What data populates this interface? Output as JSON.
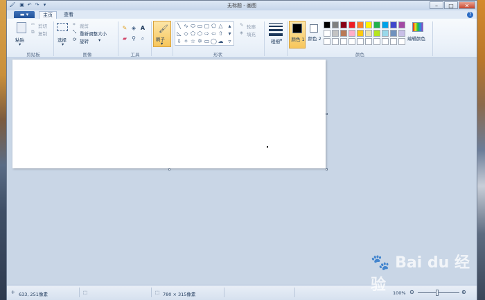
{
  "window": {
    "title": "无标题 - 画图",
    "file_menu": "▾",
    "quick_access": [
      "save-icon",
      "undo-icon",
      "redo-icon",
      "customize-icon"
    ],
    "controls": {
      "minimize": "–",
      "maximize": "□",
      "close": "✕"
    }
  },
  "tabs": {
    "home": "主页",
    "view": "查看"
  },
  "ribbon": {
    "clipboard": {
      "paste": "粘贴",
      "cut": "剪切",
      "copy": "复制",
      "label": "剪贴板"
    },
    "image": {
      "select": "选择",
      "crop": "裁剪",
      "resize": "重新调整大小",
      "rotate": "旋转",
      "label": "图像"
    },
    "tools": {
      "label": "工具"
    },
    "brushes": {
      "label": "刷子"
    },
    "shapes": {
      "outline": "轮廓",
      "fill": "填充",
      "label": "形状"
    },
    "size": {
      "label": "粗细"
    },
    "colors": {
      "color1": "颜色 1",
      "color2": "颜色 2",
      "edit": "编辑颜色",
      "label": "颜色",
      "color1_value": "#000000",
      "color2_value": "#ffffff",
      "palette_row1": [
        "#000000",
        "#7f7f7f",
        "#880015",
        "#ed1c24",
        "#ff7f27",
        "#fff200",
        "#22b14c",
        "#00a2e8",
        "#3f48cc",
        "#a349a4"
      ],
      "palette_row2": [
        "#ffffff",
        "#c3c3c3",
        "#b97a57",
        "#ffaec9",
        "#ffc90e",
        "#efe4b0",
        "#b5e61d",
        "#99d9ea",
        "#7092be",
        "#c8bfe7"
      ],
      "palette_row3": [
        "#ffffff",
        "#ffffff",
        "#ffffff",
        "#ffffff",
        "#ffffff",
        "#ffffff",
        "#ffffff",
        "#ffffff",
        "#ffffff",
        "#ffffff"
      ]
    }
  },
  "status": {
    "cursor_pos": "633, 251像素",
    "canvas_size": "780 × 315像素",
    "zoom": "100%"
  },
  "watermark": "Bai du 经验"
}
